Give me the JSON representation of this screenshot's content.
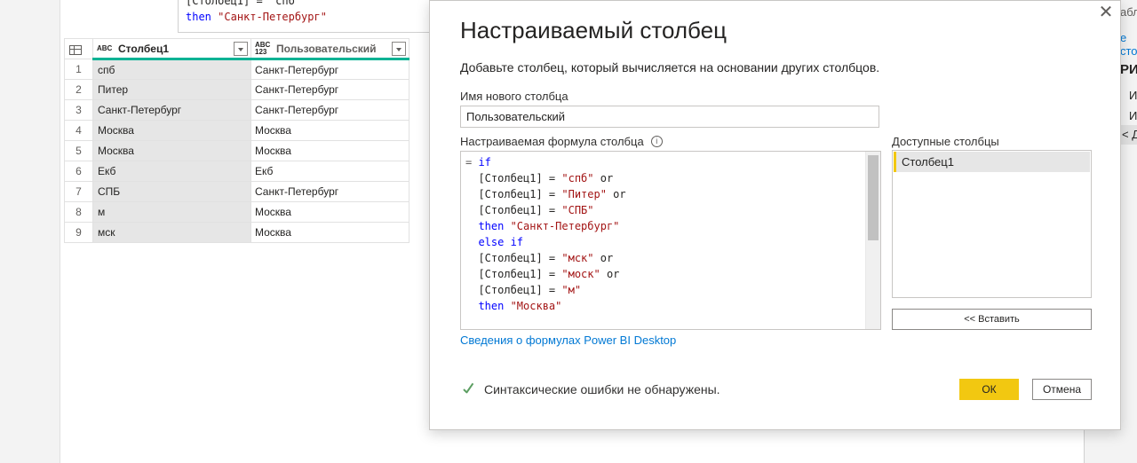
{
  "formula_bar": {
    "line1": "[Столбец1] = \"спб\"",
    "line2_kw": "then",
    "line2_str": "\"Санкт-Петербург\""
  },
  "grid": {
    "table_icon": "table-icon",
    "columns": [
      {
        "type_icon": "ABC",
        "name": "Столбец1"
      },
      {
        "type_icon": "ABC 123",
        "name": "Пользовательский"
      }
    ],
    "rows": [
      {
        "n": "1",
        "c1": "спб",
        "c2": "Санкт-Петербург"
      },
      {
        "n": "2",
        "c1": "Питер",
        "c2": "Санкт-Петербург"
      },
      {
        "n": "3",
        "c1": "Санкт-Петербург",
        "c2": "Санкт-Петербург"
      },
      {
        "n": "4",
        "c1": "Москва",
        "c2": "Москва"
      },
      {
        "n": "5",
        "c1": "Москва",
        "c2": "Москва"
      },
      {
        "n": "6",
        "c1": "Екб",
        "c2": "Екб"
      },
      {
        "n": "7",
        "c1": "СПБ",
        "c2": "Санкт-Петербург"
      },
      {
        "n": "8",
        "c1": "м",
        "c2": "Москва"
      },
      {
        "n": "9",
        "c1": "мск",
        "c2": "Москва"
      }
    ]
  },
  "right_panel": {
    "t1": "абл",
    "t2": "е сто",
    "t3": "РИМ",
    "t4": "И",
    "t5": "И",
    "t6": "Д"
  },
  "dialog": {
    "title": "Настраиваемый столбец",
    "description": "Добавьте столбец, который вычисляется на основании других столбцов.",
    "name_label": "Имя нового столбца",
    "name_value": "Пользовательский",
    "formula_label": "Настраиваемая формула столбца",
    "formula_lines": [
      [
        {
          "t": "= ",
          "c": "eq"
        },
        {
          "t": "if",
          "c": "kw"
        }
      ],
      [
        {
          "t": "  [Столбец1] = ",
          "c": "id"
        },
        {
          "t": "\"спб\"",
          "c": "str"
        },
        {
          "t": " or",
          "c": "id"
        }
      ],
      [
        {
          "t": "  [Столбец1] = ",
          "c": "id"
        },
        {
          "t": "\"Питер\"",
          "c": "str"
        },
        {
          "t": " or",
          "c": "id"
        }
      ],
      [
        {
          "t": "  [Столбец1] = ",
          "c": "id"
        },
        {
          "t": "\"СПБ\"",
          "c": "str"
        }
      ],
      [
        {
          "t": "  then",
          "c": "kw"
        },
        {
          "t": " \"Санкт-Петербург\"",
          "c": "str"
        }
      ],
      [
        {
          "t": "  else if",
          "c": "kw"
        }
      ],
      [
        {
          "t": "  [Столбец1] = ",
          "c": "id"
        },
        {
          "t": "\"мск\"",
          "c": "str"
        },
        {
          "t": " or",
          "c": "id"
        }
      ],
      [
        {
          "t": "  [Столбец1] = ",
          "c": "id"
        },
        {
          "t": "\"моск\"",
          "c": "str"
        },
        {
          "t": " or",
          "c": "id"
        }
      ],
      [
        {
          "t": "  [Столбец1] = ",
          "c": "id"
        },
        {
          "t": "\"м\"",
          "c": "str"
        }
      ],
      [
        {
          "t": "  then",
          "c": "kw"
        },
        {
          "t": " \"Москва\"",
          "c": "str"
        }
      ]
    ],
    "learn_link": "Сведения о формулах Power BI Desktop",
    "available_label": "Доступные столбцы",
    "available_columns": [
      "Столбец1"
    ],
    "insert_label": "<< Вставить",
    "status": "Синтаксические ошибки не обнаружены.",
    "ok_label": "ОК",
    "cancel_label": "Отмена",
    "close_glyph": "✕"
  },
  "colors": {
    "accent_yellow": "#f2c811",
    "accent_teal": "#00b294",
    "keyword_blue": "#0000ff",
    "string_red": "#a31515",
    "link_blue": "#0078d4",
    "ok_green": "#5c9e62"
  }
}
